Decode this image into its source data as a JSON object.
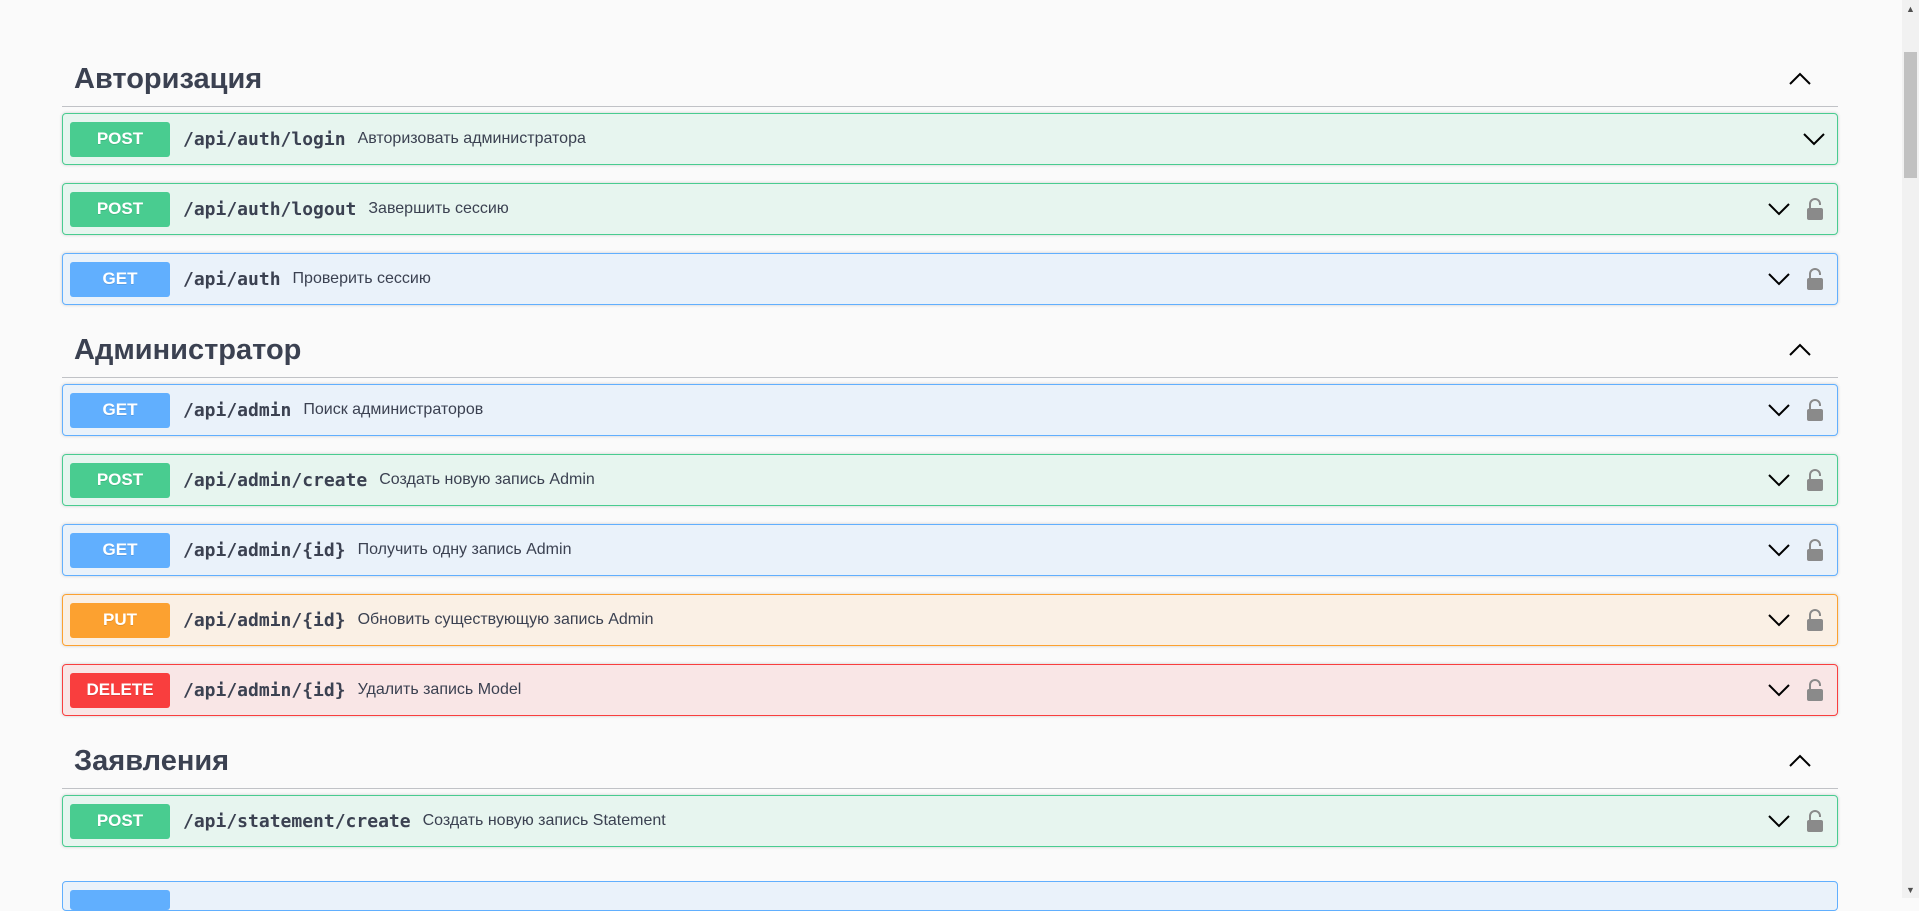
{
  "sections": [
    {
      "title": "Авторизация",
      "operations": [
        {
          "method": "POST",
          "path": "/api/auth/login",
          "summary": "Авторизовать администратора",
          "locked": false
        },
        {
          "method": "POST",
          "path": "/api/auth/logout",
          "summary": "Завершить сессию",
          "locked": true
        },
        {
          "method": "GET",
          "path": "/api/auth",
          "summary": "Проверить сессию",
          "locked": true
        }
      ]
    },
    {
      "title": "Администратор",
      "operations": [
        {
          "method": "GET",
          "path": "/api/admin",
          "summary": "Поиск администраторов",
          "locked": true
        },
        {
          "method": "POST",
          "path": "/api/admin/create",
          "summary": "Создать новую запись Admin",
          "locked": true
        },
        {
          "method": "GET",
          "path": "/api/admin/{id}",
          "summary": "Получить одну запись Admin",
          "locked": true
        },
        {
          "method": "PUT",
          "path": "/api/admin/{id}",
          "summary": "Обновить существующую запись Admin",
          "locked": true
        },
        {
          "method": "DELETE",
          "path": "/api/admin/{id}",
          "summary": "Удалить запись Model",
          "locked": true
        }
      ]
    },
    {
      "title": "Заявления",
      "operations": [
        {
          "method": "POST",
          "path": "/api/statement/create",
          "summary": "Создать новую запись Statement",
          "locked": true
        }
      ]
    }
  ],
  "colors": {
    "post": "#49cc90",
    "get": "#61affe",
    "put": "#fca130",
    "delete": "#f93e3e",
    "text": "#3b4151"
  },
  "icons": {
    "section_toggle": "chevron-up-icon",
    "op_expand": "chevron-down-icon",
    "lock": "unlocked-padlock-icon"
  }
}
